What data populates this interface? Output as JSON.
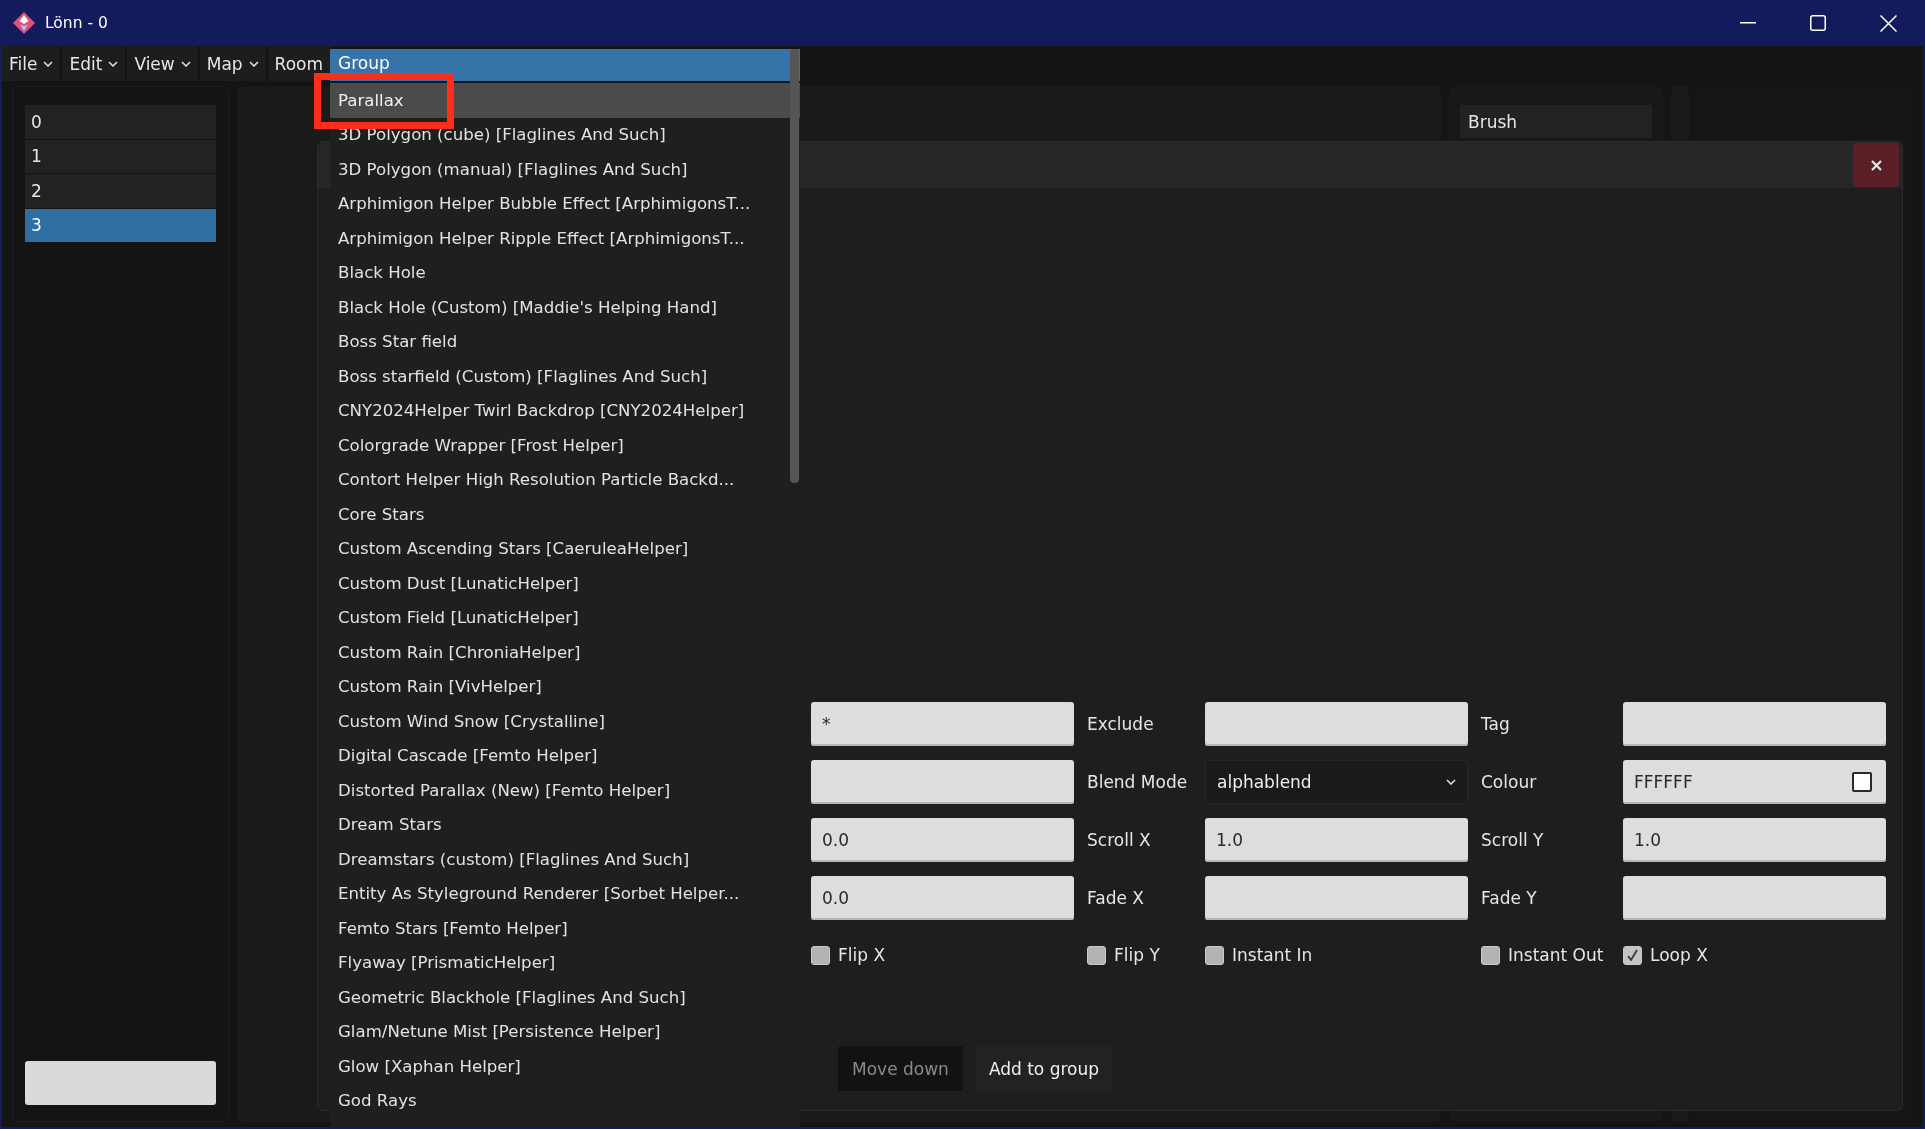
{
  "window": {
    "title": "Lönn - 0"
  },
  "menu_bar": [
    {
      "label": "File",
      "caret": true
    },
    {
      "label": "Edit",
      "caret": true
    },
    {
      "label": "View",
      "caret": true
    },
    {
      "label": "Map",
      "caret": true
    },
    {
      "label": "Room",
      "caret": false
    }
  ],
  "rooms": [
    {
      "label": "0",
      "selected": false
    },
    {
      "label": "1",
      "selected": false
    },
    {
      "label": "2",
      "selected": false
    },
    {
      "label": "3",
      "selected": true
    }
  ],
  "tools": [
    {
      "label": "Brush"
    }
  ],
  "dialog": {
    "form_rows": [
      {
        "cells": [
          {
            "kind": "input",
            "value": "*"
          },
          {
            "kind": "label",
            "text": "Exclude"
          },
          {
            "kind": "input"
          },
          {
            "kind": "label",
            "text": "Tag"
          },
          {
            "kind": "input"
          }
        ]
      },
      {
        "cells": [
          {
            "kind": "input"
          },
          {
            "kind": "label",
            "text": "Blend Mode"
          },
          {
            "kind": "select",
            "value": "alphablend"
          },
          {
            "kind": "label",
            "text": "Colour"
          },
          {
            "kind": "color",
            "value": "FFFFFF",
            "color": "#ffffff"
          }
        ]
      },
      {
        "cells": [
          {
            "kind": "input",
            "value": "0.0"
          },
          {
            "kind": "label",
            "text": "Scroll X"
          },
          {
            "kind": "input",
            "value": "1.0"
          },
          {
            "kind": "label",
            "text": "Scroll Y"
          },
          {
            "kind": "input",
            "value": "1.0"
          }
        ]
      },
      {
        "cells": [
          {
            "kind": "input",
            "value": "0.0"
          },
          {
            "kind": "label",
            "text": "Fade X"
          },
          {
            "kind": "input"
          },
          {
            "kind": "label",
            "text": "Fade Y"
          },
          {
            "kind": "input"
          }
        ]
      }
    ],
    "checkboxes": [
      {
        "label": "Flip X",
        "checked": false
      },
      {
        "label": "Flip Y",
        "checked": false
      },
      {
        "label": "Instant In",
        "checked": false
      },
      {
        "label": "Instant Out",
        "checked": false
      },
      {
        "label": "Loop X",
        "checked": true
      }
    ],
    "buttons": [
      {
        "label": "Move down",
        "disabled": true
      },
      {
        "label": "Add to group",
        "disabled": false
      }
    ]
  },
  "dropdown": {
    "value": "Group",
    "options": [
      {
        "label": "Parallax",
        "selected": true,
        "outlined": true
      },
      {
        "label": "3D Polygon (cube) [Flaglines And Such]",
        "selected": false,
        "outlined": false
      },
      {
        "label": "3D Polygon (manual) [Flaglines And Such]",
        "selected": false,
        "outlined": false
      },
      {
        "label": "Arphimigon Helper Bubble Effect [ArphimigonsT...",
        "selected": false,
        "outlined": false
      },
      {
        "label": "Arphimigon Helper Ripple Effect [ArphimigonsT...",
        "selected": false,
        "outlined": false
      },
      {
        "label": "Black Hole",
        "selected": false,
        "outlined": false
      },
      {
        "label": "Black Hole (Custom) [Maddie's Helping Hand]",
        "selected": false,
        "outlined": false
      },
      {
        "label": "Boss Star field",
        "selected": false,
        "outlined": false
      },
      {
        "label": "Boss starfield (Custom) [Flaglines And Such]",
        "selected": false,
        "outlined": false
      },
      {
        "label": "CNY2024Helper Twirl Backdrop [CNY2024Helper]",
        "selected": false,
        "outlined": false
      },
      {
        "label": "Colorgrade Wrapper [Frost Helper]",
        "selected": false,
        "outlined": false
      },
      {
        "label": "Contort Helper High Resolution Particle Backd...",
        "selected": false,
        "outlined": false
      },
      {
        "label": "Core Stars",
        "selected": false,
        "outlined": false
      },
      {
        "label": "Custom Ascending Stars [CaeruleaHelper]",
        "selected": false,
        "outlined": false
      },
      {
        "label": "Custom Dust [LunaticHelper]",
        "selected": false,
        "outlined": false
      },
      {
        "label": "Custom Field [LunaticHelper]",
        "selected": false,
        "outlined": false
      },
      {
        "label": "Custom Rain [ChroniaHelper]",
        "selected": false,
        "outlined": false
      },
      {
        "label": "Custom Rain [VivHelper]",
        "selected": false,
        "outlined": false
      },
      {
        "label": "Custom Wind Snow [Crystalline]",
        "selected": false,
        "outlined": false
      },
      {
        "label": "Digital Cascade [Femto Helper]",
        "selected": false,
        "outlined": false
      },
      {
        "label": "Distorted Parallax (New) [Femto Helper]",
        "selected": false,
        "outlined": false
      },
      {
        "label": "Dream Stars",
        "selected": false,
        "outlined": false
      },
      {
        "label": "Dreamstars (custom) [Flaglines And Such]",
        "selected": false,
        "outlined": false
      },
      {
        "label": "Entity As Styleground Renderer [Sorbet Helper...",
        "selected": false,
        "outlined": false
      },
      {
        "label": "Femto Stars [Femto Helper]",
        "selected": false,
        "outlined": false
      },
      {
        "label": "Flyaway [PrismaticHelper]",
        "selected": false,
        "outlined": false
      },
      {
        "label": "Geometric Blackhole [Flaglines And Such]",
        "selected": false,
        "outlined": false
      },
      {
        "label": "Glam/Netune Mist [Persistence Helper]",
        "selected": false,
        "outlined": false
      },
      {
        "label": "Glow [Xaphan Helper]",
        "selected": false,
        "outlined": false
      },
      {
        "label": "God Rays",
        "selected": false,
        "outlined": false
      }
    ]
  }
}
